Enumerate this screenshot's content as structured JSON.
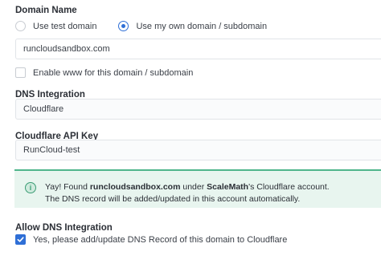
{
  "domain": {
    "label": "Domain Name",
    "options": [
      "Use test domain",
      "Use my own domain / subdomain"
    ],
    "selected_index": 1,
    "value": "runcloudsandbox.com",
    "www_label": "Enable www for this domain / subdomain",
    "www_checked": false
  },
  "dns": {
    "label": "DNS Integration",
    "value": "Cloudflare"
  },
  "cf_key": {
    "label": "Cloudflare API Key",
    "value": "RunCloud-test"
  },
  "alert": {
    "prefix": "Yay! Found ",
    "domain": "runcloudsandbox.com",
    "middle": " under ",
    "account": "ScaleMath",
    "suffix": "'s Cloudflare account.",
    "line2": "The DNS record will be added/updated in this account automatically.",
    "icon": "info-icon",
    "accent_color": "#4fb58c"
  },
  "allow_dns": {
    "label": "Allow DNS Integration",
    "checkbox_label": "Yes, please add/update DNS Record of this domain to Cloudflare",
    "checked": true
  },
  "colors": {
    "primary": "#2f6fd6",
    "success_bg": "#e8f5ef"
  }
}
